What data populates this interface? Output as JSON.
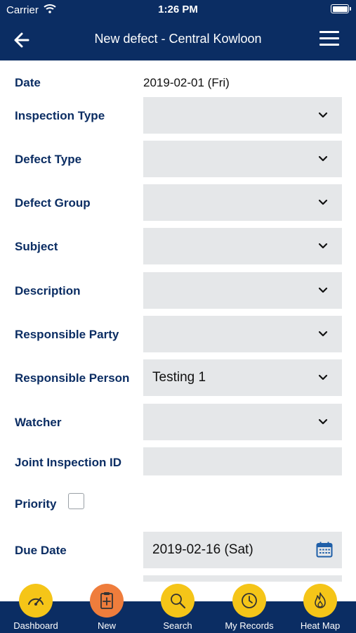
{
  "status_bar": {
    "carrier": "Carrier",
    "time": "1:26 PM"
  },
  "header": {
    "title": "New defect - Central Kowloon"
  },
  "form": {
    "date": {
      "label": "Date",
      "value": "2019-02-01 (Fri)"
    },
    "inspection_type": {
      "label": "Inspection Type",
      "value": ""
    },
    "defect_type": {
      "label": "Defect Type",
      "value": ""
    },
    "defect_group": {
      "label": "Defect Group",
      "value": ""
    },
    "subject": {
      "label": "Subject",
      "value": ""
    },
    "description": {
      "label": "Description",
      "value": ""
    },
    "responsible_party": {
      "label": "Responsible Party",
      "value": ""
    },
    "responsible_person": {
      "label": "Responsible Person",
      "value": "Testing 1"
    },
    "watcher": {
      "label": "Watcher",
      "value": ""
    },
    "joint_inspection_id": {
      "label": "Joint Inspection ID",
      "value": ""
    },
    "priority": {
      "label": "Priority",
      "checked": false
    },
    "due_date": {
      "label": "Due Date",
      "value": "2019-02-16 (Sat)"
    }
  },
  "tabs": [
    {
      "label": "Dashboard",
      "icon": "gauge-icon",
      "color": "#f5c518"
    },
    {
      "label": "New",
      "icon": "clipboard-plus-icon",
      "color": "#ef7d3c"
    },
    {
      "label": "Search",
      "icon": "magnifier-icon",
      "color": "#f5c518"
    },
    {
      "label": "My Records",
      "icon": "clock-icon",
      "color": "#f5c518"
    },
    {
      "label": "Heat Map",
      "icon": "flame-icon",
      "color": "#f5c518"
    }
  ],
  "colors": {
    "primary": "#0b2d63",
    "field_bg": "#e5e7e9",
    "accent_yellow": "#f5c518",
    "accent_orange": "#ef7d3c"
  }
}
